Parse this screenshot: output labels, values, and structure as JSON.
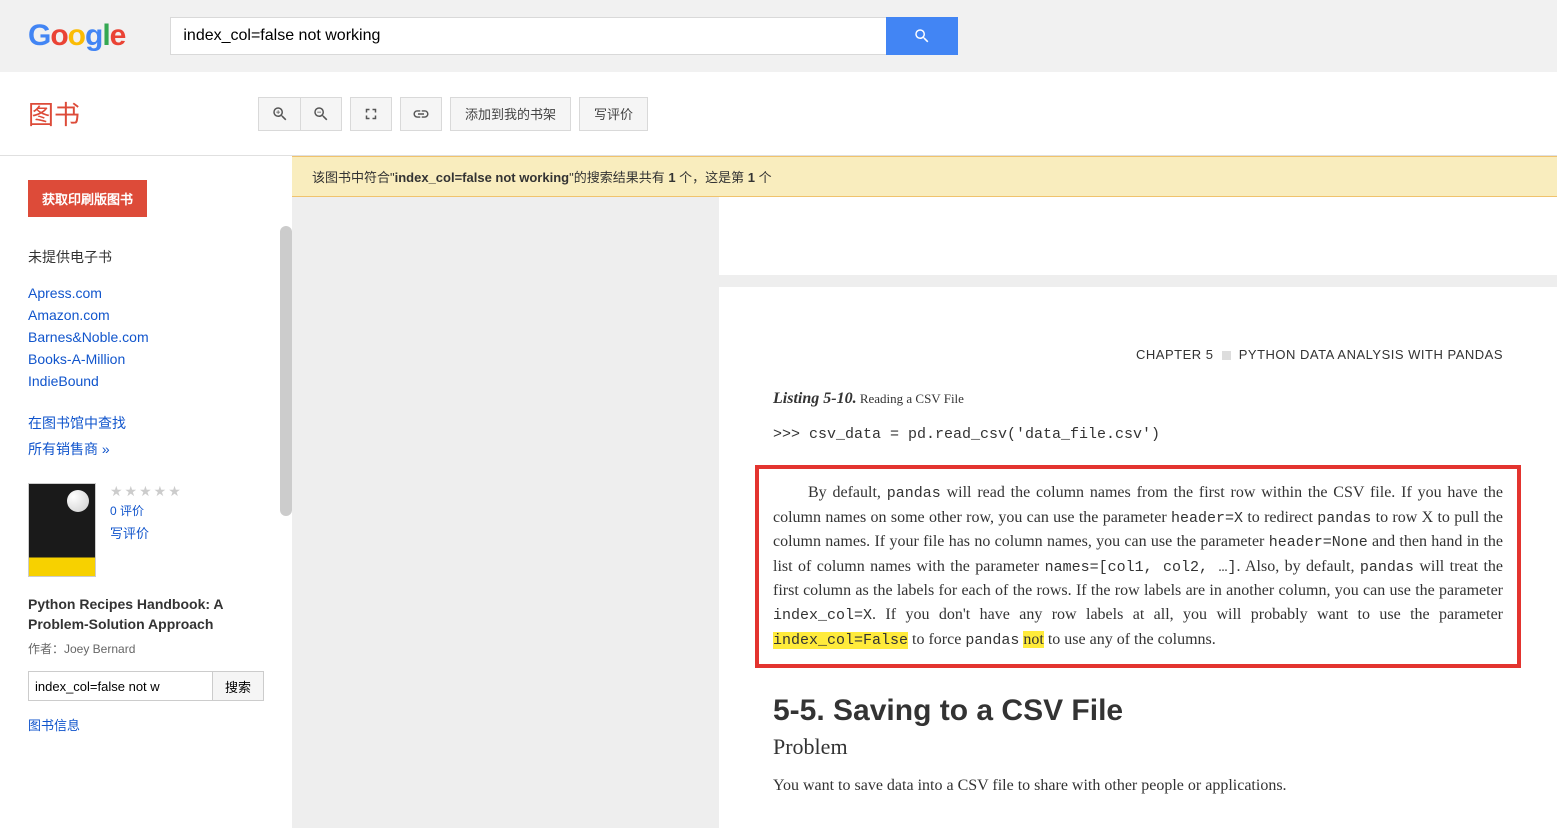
{
  "header": {
    "search_value": "index_col=false not working"
  },
  "toolbar": {
    "brand": "图书",
    "add_shelf": "添加到我的书架",
    "write_review": "写评价"
  },
  "sidebar": {
    "print_button": "获取印刷版图书",
    "no_ebook": "未提供电子书",
    "sellers": [
      "Apress.com",
      "Amazon.com",
      "Barnes&Noble.com",
      "Books-A-Million",
      "IndieBound"
    ],
    "find_library": "在图书馆中查找",
    "all_sellers": "所有销售商 »",
    "rating_count": "0 评价",
    "write_review_link": "写评价",
    "book_title": "Python Recipes Handbook: A Problem-Solution Approach",
    "book_author": "作者：Joey Bernard",
    "inbook_search_value": "index_col=false not w",
    "search_btn": "搜索",
    "book_info_link": "图书信息"
  },
  "result_bar": {
    "prefix": "该图书中符合\"",
    "query": "index_col=false not working",
    "mid": "\"的搜索结果共有 ",
    "total": "1",
    "mid2": " 个，这是第 ",
    "current": "1",
    "suffix": " 个"
  },
  "page": {
    "chapter_header_left": "CHAPTER 5",
    "chapter_header_right": "PYTHON DATA ANALYSIS WITH PANDAS",
    "listing_label": "Listing 5-10.",
    "listing_title": "Reading a CSV File",
    "code": ">>> csv_data = pd.read_csv('data_file.csv')",
    "para": {
      "t1": "By default, ",
      "c1": "pandas",
      "t2": " will read the column names from the first row within the CSV file. If you have the column names on some other row, you can use the parameter ",
      "c2": "header=X",
      "t3": " to redirect ",
      "c3": "pandas",
      "t4": " to row X to pull the column names. If your file has no column names, you can use the parameter ",
      "c4": "header=None",
      "t5": " and then hand in the list of column names with the parameter ",
      "c5": "names=[col1, col2, …]",
      "t6": ". Also, by default, ",
      "c6": "pandas",
      "t7": " will treat the first column as the labels for each of the rows. If the row labels are in another column, you can use the parameter ",
      "c7": "index_col=X",
      "t8": ". If you don't have any row labels at all, you will probably want to use the parameter ",
      "h1": "index_col=False",
      "t9": " to force ",
      "c8": "pandas",
      "t10": " ",
      "h2": "not",
      "t11": " to use any of the columns."
    },
    "section_title": "5-5. Saving to a CSV File",
    "subsection": "Problem",
    "body": "You want to save data into a CSV file to share with other people or applications."
  }
}
